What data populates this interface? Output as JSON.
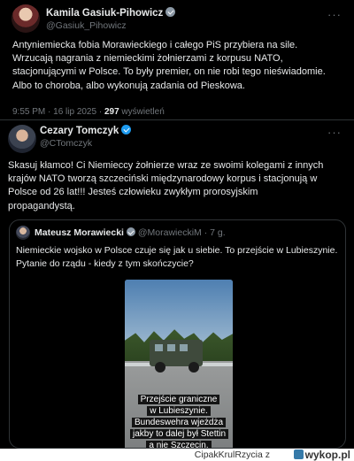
{
  "tweet1": {
    "name": "Kamila Gasiuk-Pihowicz",
    "handle": "@Gasiuk_Pihowicz",
    "text": "Antyniemiecka fobia Morawieckiego i całego PiS przybiera na sile.\nWrzucają nagrania z niemieckimi  żołnierzami z korpusu NATO,\nstacjonującymi w Polsce. To były premier, on nie robi tego nieświadomie.\nAlbo to choroba, albo wykonują zadania od Pieskowa.",
    "time": "9:55 PM · 16 lip 2025 ·",
    "views_count": "297",
    "views_label": "wyświetleń",
    "more": "···"
  },
  "tweet2": {
    "name": "Cezary Tomczyk",
    "handle": "@CTomczyk",
    "text": "Skasuj kłamco! Ci Niemieccy żołnierze wraz ze swoimi kolegami z innych\nkrajów NATO tworzą szczeciński międzynarodowy korpus i stacjonują w\nPolsce od 26 lat!!! Jesteś człowieku zwykłym prorosyjskim\npropagandystą.",
    "more": "···"
  },
  "quote": {
    "name": "Mateusz Morawiecki",
    "handle": "@MorawieckiM · 7 g.",
    "text": "Niemieckie wojsko w Polsce czuje się jak u siebie. To przejście w Lubieszynie.\nPytanie do rządu - kiedy z tym skończycie?",
    "video_caption": "Przejście graniczne\nw Lubieszynie.\nBundeswehra wjeżdża\njakby to dalej był Stettin\na nie Szczecin."
  },
  "footer": {
    "source": "CipakKrulRzycia  z",
    "site": "wykop.pl"
  }
}
